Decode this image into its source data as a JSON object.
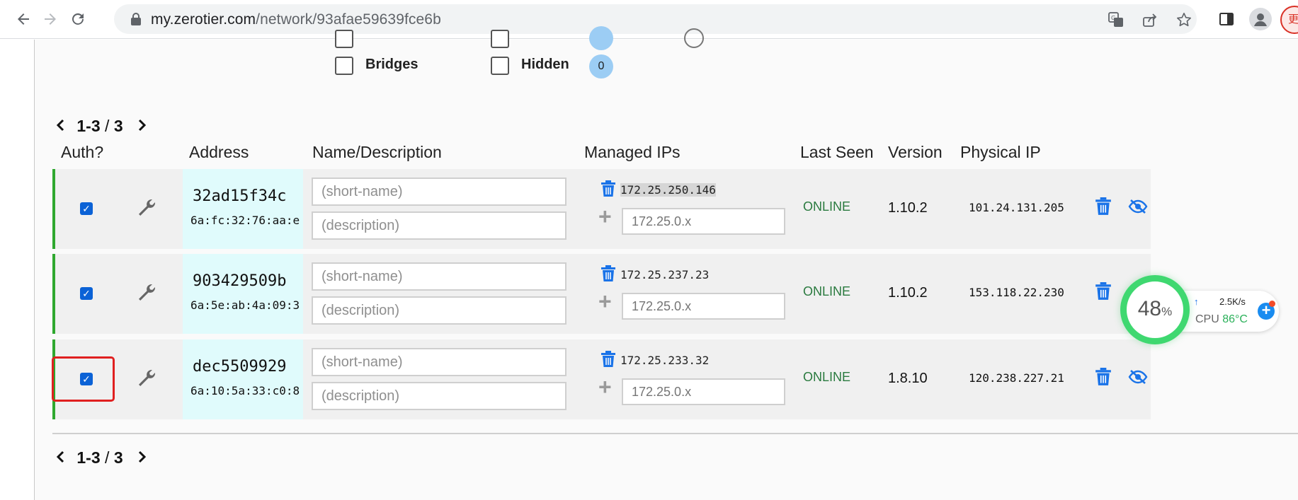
{
  "browser": {
    "url_host": "my.zerotier.com",
    "url_path": "/network/93afae59639fce6b",
    "extension_badge": "更"
  },
  "flags": {
    "bridges_label": "Bridges",
    "hidden_label": "Hidden",
    "hidden_count": "0"
  },
  "pager": {
    "range": "1-3",
    "separator": "/",
    "total": "3"
  },
  "columns": {
    "auth": "Auth?",
    "address": "Address",
    "name": "Name/Description",
    "managed_ips": "Managed IPs",
    "last_seen": "Last Seen",
    "version": "Version",
    "physical_ip": "Physical IP"
  },
  "members": [
    {
      "address": "32ad15f34c",
      "mac": "6a:fc:32:76:aa:e",
      "name_placeholder": "(short-name)",
      "desc_placeholder": "(description)",
      "managed_ip": "172.25.250.146",
      "ip_placeholder": "172.25.0.x",
      "last_seen": "ONLINE",
      "version": "1.10.2",
      "physical_ip": "101.24.131.205"
    },
    {
      "address": "903429509b",
      "mac": "6a:5e:ab:4a:09:3",
      "name_placeholder": "(short-name)",
      "desc_placeholder": "(description)",
      "managed_ip": "172.25.237.23",
      "ip_placeholder": "172.25.0.x",
      "last_seen": "ONLINE",
      "version": "1.10.2",
      "physical_ip": "153.118.22.230"
    },
    {
      "address": "dec5509929",
      "mac": "6a:10:5a:33:c0:8",
      "name_placeholder": "(short-name)",
      "desc_placeholder": "(description)",
      "managed_ip": "172.25.233.32",
      "ip_placeholder": "172.25.0.x",
      "last_seen": "ONLINE",
      "version": "1.8.10",
      "physical_ip": "120.238.227.21"
    }
  ],
  "cpu_widget": {
    "percent": "48",
    "percent_unit": "%",
    "net_speed": "2.5K/s",
    "cpu_label": "CPU",
    "temperature": "86°C"
  },
  "colors": {
    "online_border": "#2fa82f",
    "address_bg": "#e0fbfc",
    "checkbox_blue": "#0b62d6",
    "action_blue": "#1a73e8",
    "highlight_red": "#e02020"
  }
}
